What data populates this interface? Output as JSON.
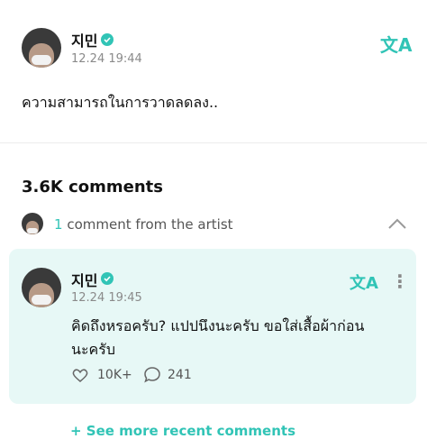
{
  "post": {
    "author_name": "지민",
    "timestamp": "12.24 19:44",
    "body_text": "ความสามารถในการวาดลดลง..",
    "translate_icon_glyph": "文A"
  },
  "comments_section": {
    "count_label": "3.6K comments",
    "artist_count": "1",
    "artist_label": "comment from the artist"
  },
  "artist_comment": {
    "author_name": "지민",
    "timestamp": "12.24 19:45",
    "text_line1": "คิดถึงหรอครับ? แปปนึงนะครับ ขอใส่เสื้อผ้าก่อน",
    "text_line2": "นะครับ",
    "likes": "10K+",
    "replies": "241",
    "translate_icon_glyph": "文A",
    "more_glyph": "⋮"
  },
  "footer": {
    "see_more_label": "+ See more recent comments"
  },
  "colors": {
    "accent": "#31c4b6",
    "card_bg": "#e7f8f6"
  }
}
